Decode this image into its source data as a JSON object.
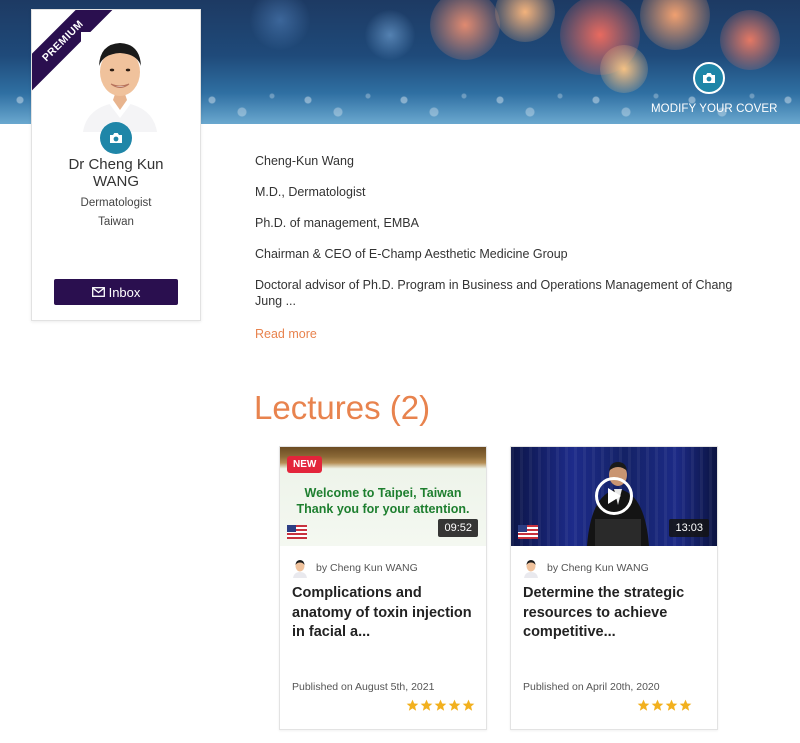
{
  "cover": {
    "modify_label": "MODIFY YOUR COVER",
    "camera_icon": "camera-icon"
  },
  "profile": {
    "badge": "PREMIUM",
    "name": "Dr Cheng Kun\nWANG",
    "specialty": "Dermatologist",
    "country": "Taiwan",
    "inbox_label": "Inbox",
    "inbox_icon": "envelope-icon",
    "accent": "#2a0f4f"
  },
  "bio": {
    "lines": [
      "Cheng-Kun Wang",
      "M.D., Dermatologist",
      "Ph.D. of management, EMBA",
      "Chairman & CEO of E-Champ Aesthetic Medicine Group",
      "Doctoral advisor of Ph.D. Program in Business and Operations Management of Chang Jung ..."
    ],
    "read_more": "Read more"
  },
  "lectures": {
    "title": "Lectures (2)",
    "accent": "#e8834e",
    "items": [
      {
        "badge": "NEW",
        "thumb_text": "Welcome to Taipei, Taiwan\nThank you for your attention.",
        "flag_icon": "us-flag-icon",
        "duration": "09:52",
        "author": "by Cheng Kun WANG",
        "title": "Complications and anatomy of toxin injection in facial a...",
        "published": "Published on August 5th, 2021",
        "rating": 5
      },
      {
        "flag_icon": "us-flag-icon",
        "duration": "13:03",
        "author": "by Cheng Kun WANG",
        "title": "Determine the strategic resources to achieve competitive...",
        "published": "Published on April 20th, 2020",
        "rating": 4
      }
    ]
  }
}
